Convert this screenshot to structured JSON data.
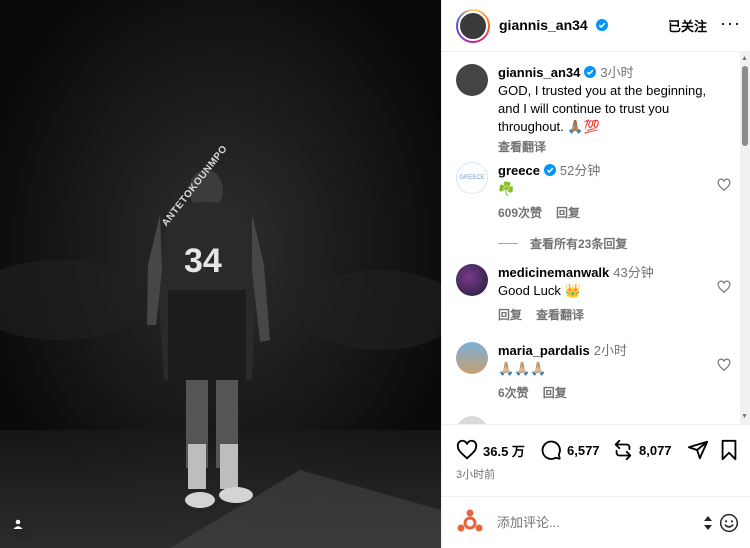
{
  "post": {
    "username": "giannis_an34",
    "follow_state": "已关注",
    "more_label": "···"
  },
  "caption": {
    "username": "giannis_an34",
    "time": "3小时",
    "text": "GOD, I trusted you at the beginning, and I will continue to trust you throughout. 🙏🏽💯",
    "translate": "查看翻译"
  },
  "comments": [
    {
      "username": "greece",
      "time": "52分钟",
      "text": "☘️",
      "likes": "609次赞",
      "reply": "回复"
    },
    {
      "username": "medicinemanwalk",
      "time": "43分钟",
      "text": "Good Luck 👑",
      "reply": "回复",
      "translate": "查看翻译"
    },
    {
      "username": "maria_pardalis",
      "time": "2小时",
      "text": "🙏🏼🙏🏼🙏🏼",
      "likes": "6次赞",
      "reply": "回复"
    }
  ],
  "view_replies": "查看所有23条回复",
  "stats": {
    "likes": "36.5 万",
    "comments": "6,577",
    "reposts": "8,077"
  },
  "posted_time": "3小时前",
  "add_comment": {
    "placeholder": "添加评论..."
  },
  "photo": {
    "jersey_name": "ANTETOKOUNMPO",
    "jersey_number": "34"
  },
  "colors": {
    "verified": "#0095f6",
    "muted_text": "#737373",
    "photo_bg": "#0d0d0d"
  },
  "icons": [
    "heart-icon",
    "comment-icon",
    "repost-icon",
    "share-icon",
    "bookmark-icon",
    "verified-icon",
    "emoji-icon",
    "user-tag-icon"
  ]
}
